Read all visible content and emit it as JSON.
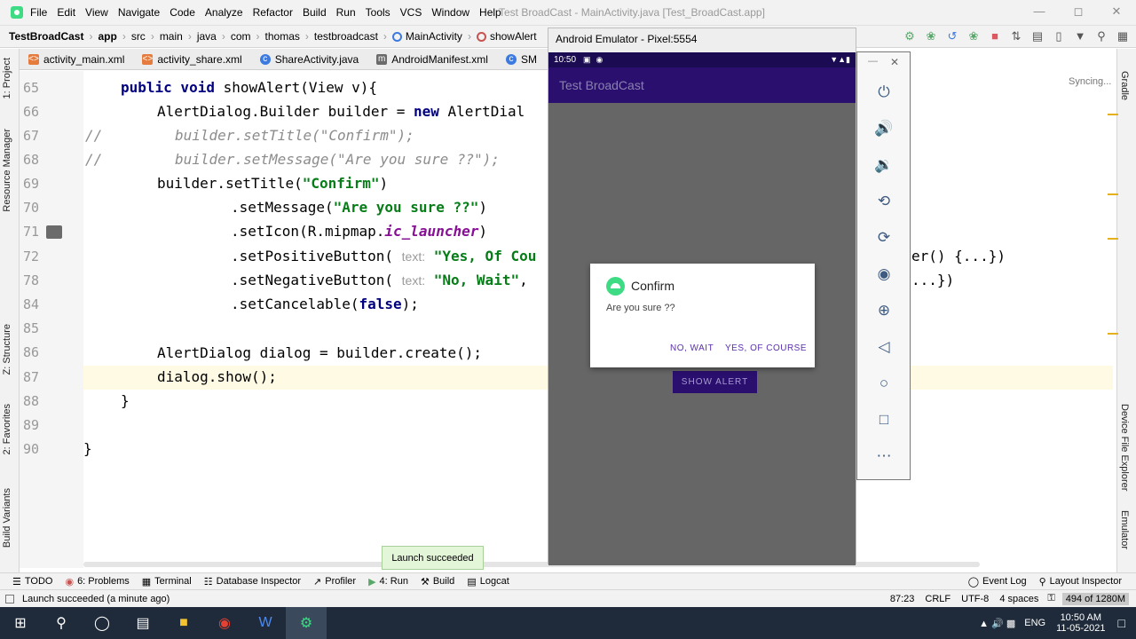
{
  "window": {
    "title": "Test BroadCast - MainActivity.java [Test_BroadCast.app]",
    "menu": [
      "File",
      "Edit",
      "View",
      "Navigate",
      "Code",
      "Analyze",
      "Refactor",
      "Build",
      "Run",
      "Tools",
      "VCS",
      "Window",
      "Help"
    ]
  },
  "breadcrumb": [
    "TestBroadCast",
    "app",
    "src",
    "main",
    "java",
    "com",
    "thomas",
    "testbroadcast",
    "MainActivity",
    "showAlert"
  ],
  "tabs": [
    "activity_main.xml",
    "activity_share.xml",
    "ShareActivity.java",
    "AndroidManifest.xml",
    "SM"
  ],
  "left_tools": [
    "1: Project",
    "Resource Manager",
    "Z: Structure",
    "2: Favorites",
    "Build Variants"
  ],
  "right_tools": [
    "Gradle",
    "Device File Explorer",
    "Emulator"
  ],
  "editor": {
    "syncing": "Syncing...",
    "line_numbers": [
      "65",
      "66",
      "67",
      "68",
      "69",
      "70",
      "71",
      "72",
      "78",
      "84",
      "85",
      "86",
      "87",
      "88",
      "89",
      "90"
    ],
    "lines": {
      "l65a": "public void",
      "l65b": " showAlert(View v){",
      "l66a": "AlertDialog.Builder builder = ",
      "l66b": "new",
      "l66c": " AlertDial",
      "l67a": "//",
      "l67b": "builder.setTitle(\"Confirm\");",
      "l68a": "//",
      "l68b": "builder.setMessage(\"Are you sure ??\");",
      "l69a": "builder.setTitle(",
      "l69b": "\"Confirm\"",
      "l69c": ")",
      "l70a": ".setMessage(",
      "l70b": "\"Are you sure ??\"",
      "l70c": ")",
      "l71a": ".setIcon(R.mipmap.",
      "l71b": "ic_launcher",
      "l71c": ")",
      "l72a": ".setPositiveButton( ",
      "l72h": "text:",
      "l72b": " \"Yes, Of Cou",
      "l72r": "er() {...})",
      "l78a": ".setNegativeButton( ",
      "l78h": "text:",
      "l78b": " \"No, Wait\"",
      "l78c": ",",
      "l78r": "...})",
      "l84a": ".setCancelable(",
      "l84b": "false",
      "l84c": ");",
      "l86a": "AlertDialog dialog = builder.create();",
      "l87a": "dialog.show();",
      "l88a": "}",
      "l90a": "}"
    }
  },
  "emulator": {
    "title": "Android Emulator - Pixel:5554",
    "time": "10:50",
    "app_title": "Test BroadCast",
    "button": "SHOW ALERT",
    "dialog": {
      "title": "Confirm",
      "message": "Are you sure ??",
      "negative": "NO, WAIT",
      "positive": "YES, OF COURSE"
    }
  },
  "toast": "Launch succeeded",
  "bottom_tools": [
    "TODO",
    "6: Problems",
    "Terminal",
    "Database Inspector",
    "Profiler",
    "4: Run",
    "Build",
    "Logcat"
  ],
  "bottom_right_tools": [
    "Event Log",
    "Layout Inspector"
  ],
  "status": {
    "message": "Launch succeeded (a minute ago)",
    "position": "87:23",
    "line_sep": "CRLF",
    "encoding": "UTF-8",
    "indent": "4 spaces",
    "memory": "494 of 1280M"
  },
  "taskbar": {
    "lang": "ENG",
    "time": "10:50 AM",
    "date": "11-05-2021"
  }
}
